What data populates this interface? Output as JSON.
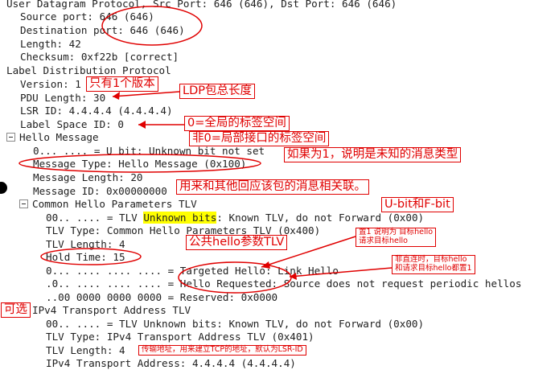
{
  "tree": [
    {
      "text": "User Datagram Protocol, Src Port: 646 (646), Dst Port: 646 (646)"
    },
    {
      "text": "Source port: 646 (646)"
    },
    {
      "text": "Destination port: 646 (646)"
    },
    {
      "text": "Length: 42"
    },
    {
      "text": "Checksum: 0xf22b [correct]"
    },
    {
      "text": "Label Distribution Protocol"
    },
    {
      "text": "Version: 1"
    },
    {
      "text": "PDU Length: 30"
    },
    {
      "text": "LSR ID: 4.4.4.4 (4.4.4.4)"
    },
    {
      "text": "Label Space ID: 0"
    },
    {
      "text": "Hello Message"
    },
    {
      "text": "0... .... = U bit: Unknown bit not set"
    },
    {
      "text": "Message Type: Hello Message (0x100)"
    },
    {
      "text": "Message Length: 20"
    },
    {
      "text": "Message ID: 0x00000000"
    },
    {
      "text": "Common Hello Parameters TLV"
    },
    {
      "pre": "00.. .... = TLV ",
      "hl": "Unknown bits",
      "post": ": Known TLV, do not Forward (0x00)"
    },
    {
      "text": "TLV Type: Common Hello Parameters TLV (0x400)"
    },
    {
      "text": "TLV Length: 4"
    },
    {
      "text": "Hold Time: 15"
    },
    {
      "text": "0... .... .... .... = Targeted Hello: Link Hello"
    },
    {
      "text": ".0.. .... .... .... = Hello Requested: Source does not request periodic hellos"
    },
    {
      "text": "..00 0000 0000 0000 = Reserved: 0x0000"
    },
    {
      "text": "IPv4 Transport Address TLV"
    },
    {
      "text": "00.. .... = TLV Unknown bits: Known TLV, do not Forward (0x00)"
    },
    {
      "text": "TLV Type: IPv4 Transport Address TLV (0x401)"
    },
    {
      "text": "TLV Length: 4"
    },
    {
      "text": "IPv4 Transport Address: 4.4.4.4 (4.4.4.4)"
    }
  ],
  "annotations": {
    "one_version": "只有1个版本",
    "pdu_total_length": "LDP包总长度",
    "space_global": "0=全局的标签空间",
    "space_interface": "非0=局部接口的标签空间",
    "u_bit_note": "如果为1，说明是未知的消息类型",
    "message_id_note": "用来和其他回应该包的消息相关联。",
    "u_f_bit": "U-bit和F-bit",
    "set1_line1": "置1 说明为 目标hello",
    "set1_line2": "请求目标hello",
    "common_hello_tlv": "公共hello参数TLV",
    "non_direct_line1": "非直连时，目标hello",
    "non_direct_line2": "和请求目标hello都置1",
    "optional": "可选",
    "transport_address_note": "传输地址，用来建立TCP的地址，默认为LSR-ID"
  },
  "colors": {
    "annotation_red": "#e00000",
    "highlight_yellow": "#ffff00",
    "tree_text": "#202020"
  }
}
